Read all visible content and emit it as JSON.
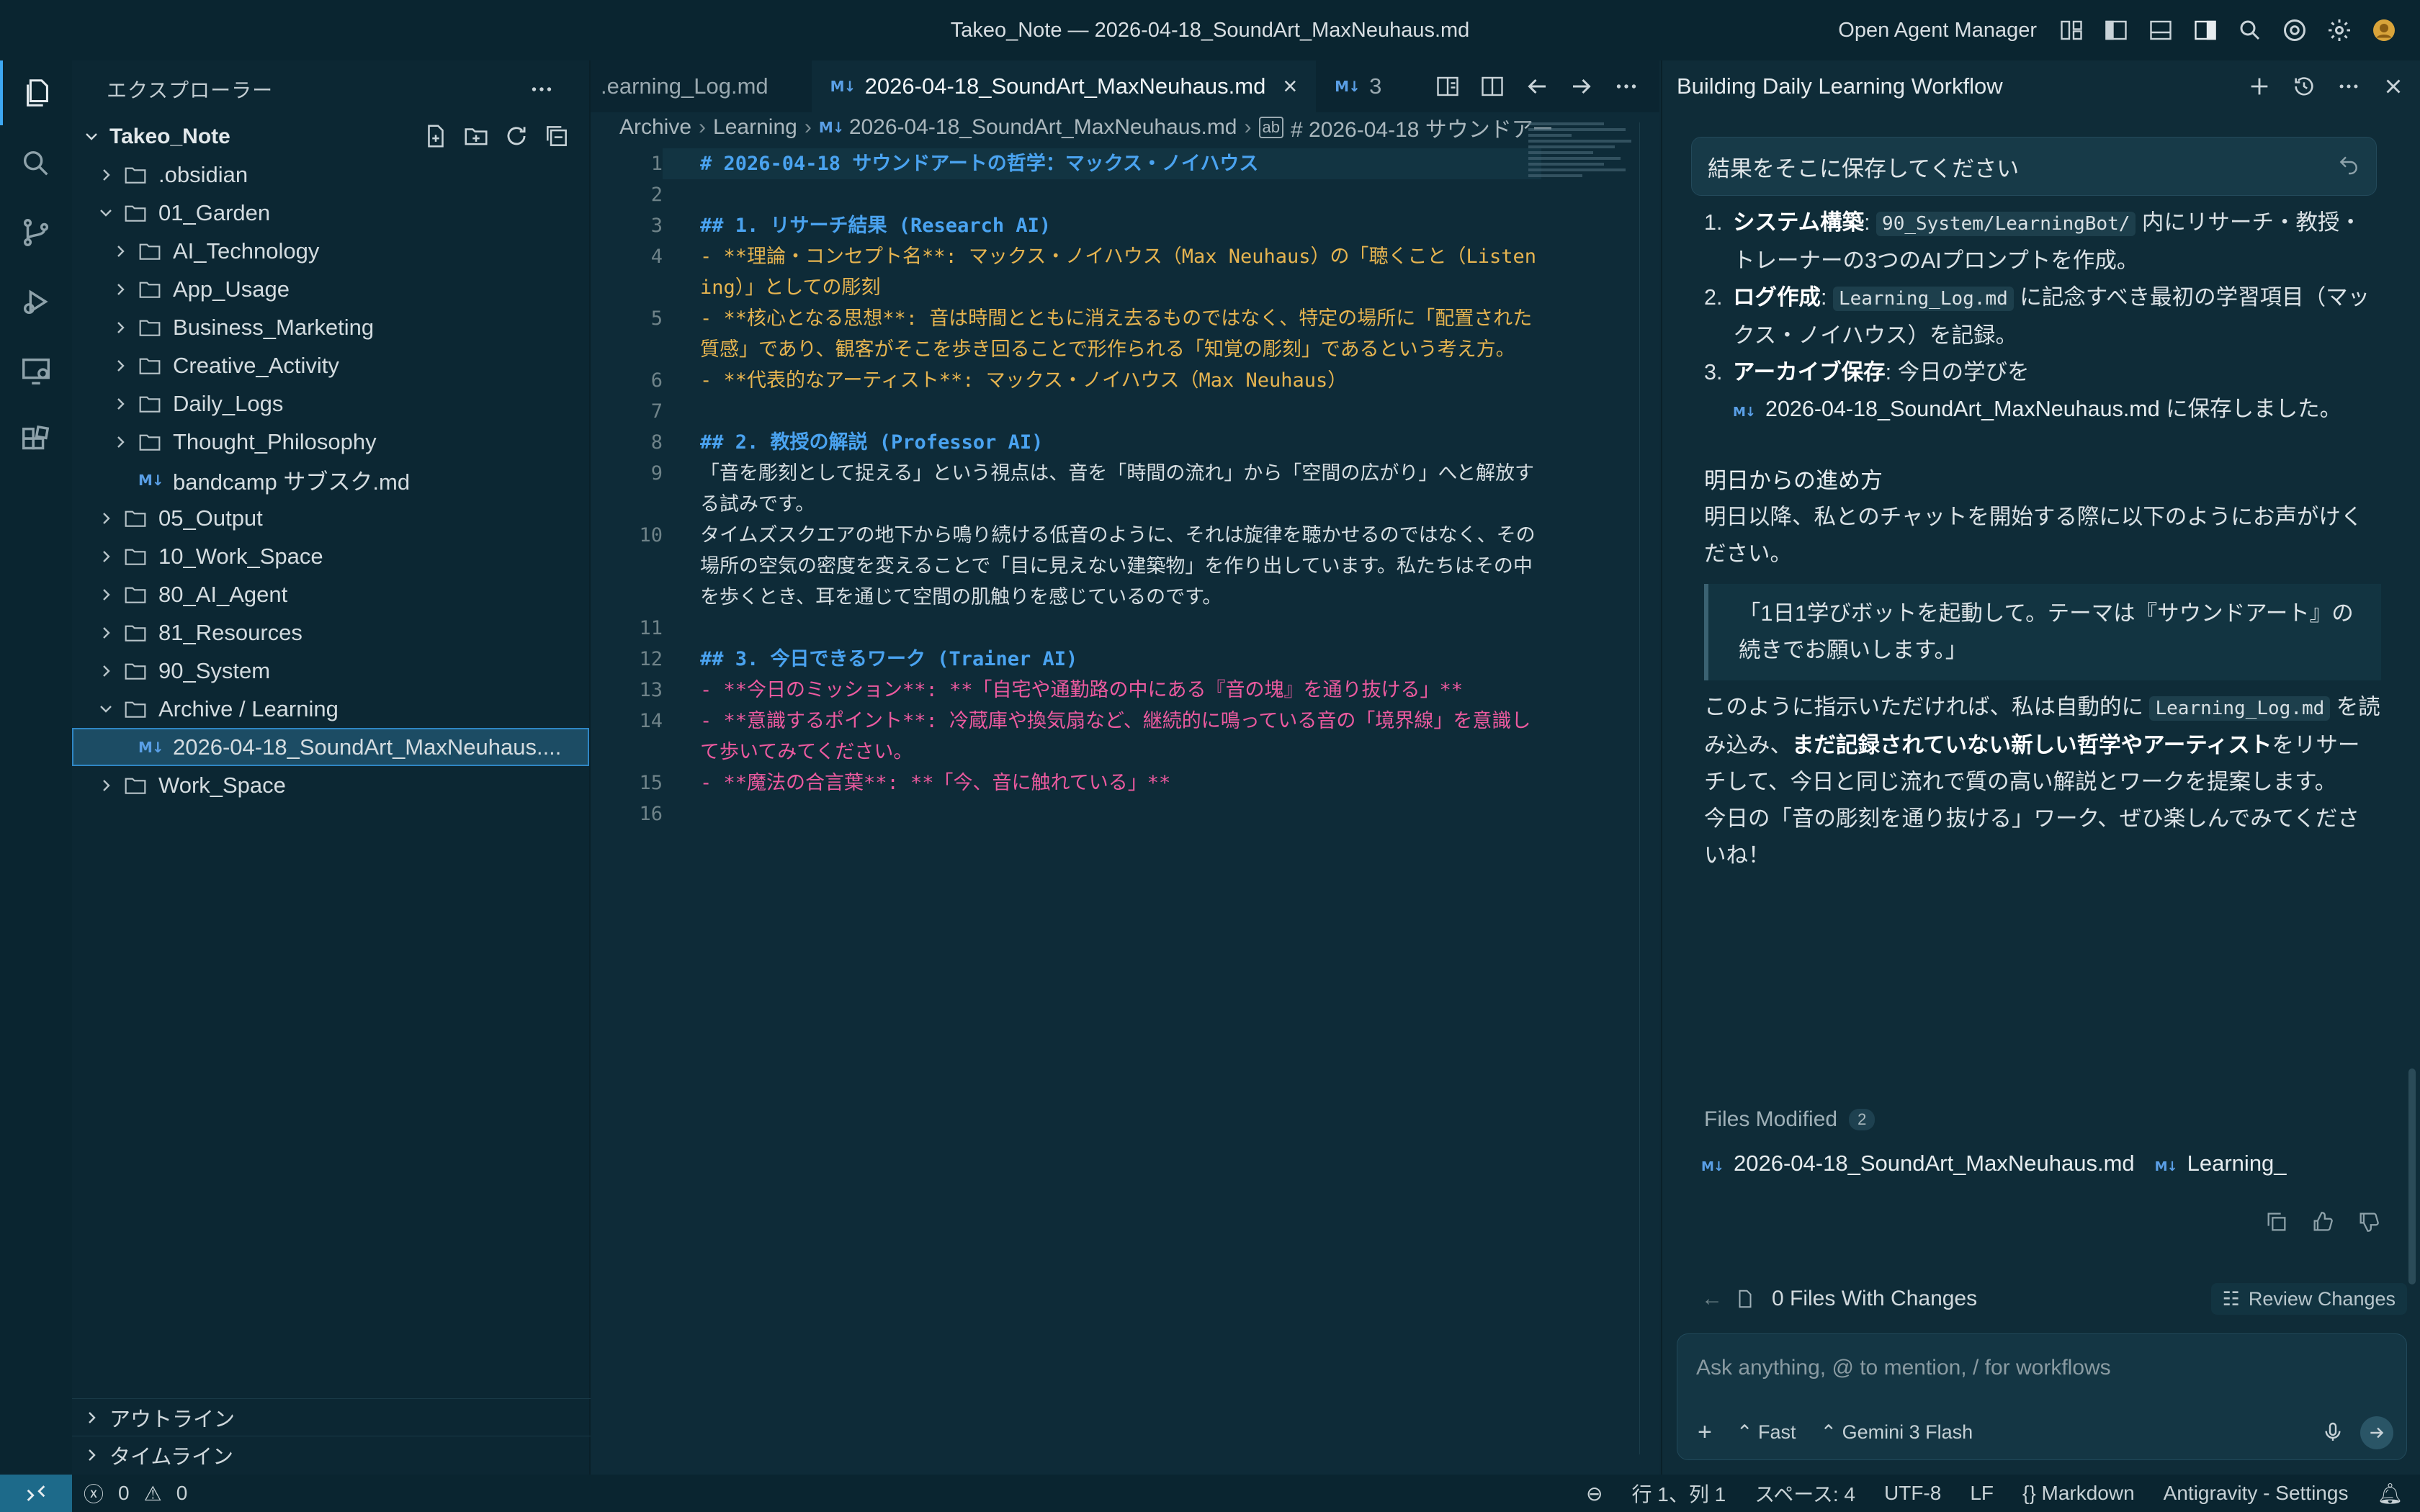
{
  "window": {
    "title": "Takeo_Note — 2026-04-18_SoundArt_MaxNeuhaus.md",
    "agent_manager": "Open Agent Manager"
  },
  "sidebar": {
    "title": "エクスプローラー",
    "root": "Takeo_Note",
    "items": [
      {
        "label": ".obsidian",
        "type": "folder"
      },
      {
        "label": "01_Garden",
        "type": "folder-open"
      },
      {
        "label": "AI_Technology",
        "type": "folder"
      },
      {
        "label": "App_Usage",
        "type": "folder"
      },
      {
        "label": "Business_Marketing",
        "type": "folder"
      },
      {
        "label": "Creative_Activity",
        "type": "folder"
      },
      {
        "label": "Daily_Logs",
        "type": "folder"
      },
      {
        "label": "Thought_Philosophy",
        "type": "folder"
      },
      {
        "label": "bandcamp サブスク.md",
        "type": "file"
      },
      {
        "label": "05_Output",
        "type": "folder"
      },
      {
        "label": "10_Work_Space",
        "type": "folder"
      },
      {
        "label": "80_AI_Agent",
        "type": "folder"
      },
      {
        "label": "81_Resources",
        "type": "folder"
      },
      {
        "label": "90_System",
        "type": "folder"
      },
      {
        "label": "Archive / Learning",
        "type": "folder-open"
      },
      {
        "label": "2026-04-18_SoundArt_MaxNeuhaus....",
        "type": "file"
      },
      {
        "label": "Work_Space",
        "type": "folder"
      }
    ],
    "outline": "アウトライン",
    "timeline": "タイムライン"
  },
  "editor": {
    "tabs": [
      {
        "label": ".earning_Log.md"
      },
      {
        "label": "2026-04-18_SoundArt_MaxNeuhaus.md"
      },
      {
        "label": "3"
      }
    ],
    "breadcrumb": [
      "Archive",
      "Learning",
      "2026-04-18_SoundArt_MaxNeuhaus.md",
      "# 2026-04-18 サウンドアー"
    ],
    "lines": [
      {
        "n": "1",
        "text": "# 2026-04-18 サウンドアートの哲学：マックス・ノイハウス"
      },
      {
        "n": "2",
        "text": ""
      },
      {
        "n": "3",
        "text": "## 1. リサーチ結果 (Research AI)"
      },
      {
        "n": "4",
        "text": "- **理論・コンセプト名**: マックス・ノイハウス（Max Neuhaus）の「聴くこと（Listening）」としての彫刻"
      },
      {
        "n": "5",
        "text": "- **核心となる思想**: 音は時間とともに消え去るものではなく、特定の場所に「配置された質感」であり、観客がそこを歩き回ることで形作られる「知覚の彫刻」であるという考え方。"
      },
      {
        "n": "6",
        "text": "- **代表的なアーティスト**: マックス・ノイハウス（Max Neuhaus）"
      },
      {
        "n": "7",
        "text": ""
      },
      {
        "n": "8",
        "text": "## 2. 教授の解説 (Professor AI)"
      },
      {
        "n": "9",
        "text": "「音を彫刻として捉える」という視点は、音を「時間の流れ」から「空間の広がり」へと解放する試みです。"
      },
      {
        "n": "10",
        "text": "タイムズスクエアの地下から鳴り続ける低音のように、それは旋律を聴かせるのではなく、その場所の空気の密度を変えることで「目に見えない建築物」を作り出しています。私たちはその中を歩くとき、耳を通じて空間の肌触りを感じているのです。"
      },
      {
        "n": "11",
        "text": ""
      },
      {
        "n": "12",
        "text": "## 3. 今日できるワーク (Trainer AI)"
      },
      {
        "n": "13",
        "text": "- **今日のミッション**: **「自宅や通勤路の中にある『音の塊』を通り抜ける」**"
      },
      {
        "n": "14",
        "text": "- **意識するポイント**: 冷蔵庫や換気扇など、継続的に鳴っている音の「境界線」を意識して歩いてみてください。"
      },
      {
        "n": "15",
        "text": "- **魔法の合言葉**: **「今、音に触れている」**"
      },
      {
        "n": "16",
        "text": ""
      }
    ]
  },
  "panel": {
    "title": "Building Daily Learning Workflow",
    "user_message": "結果をそこに保存してください",
    "steps": [
      {
        "num": "1.",
        "bold": "システム構築",
        "code": "90_System/LearningBot/",
        "rest": " 内にリサーチ・教授・トレーナーの3つのAIプロンプトを作成。"
      },
      {
        "num": "2.",
        "bold": "ログ作成",
        "code": "Learning_Log.md",
        "rest": " に記念すべき最初の学習項目（マックス・ノイハウス）を記録。"
      },
      {
        "num": "3.",
        "bold": "アーカイブ保存",
        "pre": ": 今日の学びを",
        "file": "2026-04-18_SoundArt_MaxNeuhaus.md",
        "rest": " に保存しました。"
      }
    ],
    "next_title": "明日からの進め方",
    "next_text": "明日以降、私とのチャットを開始する際に以下のようにお声がけください。",
    "quote": "「1日1学びボットを起動して。テーマは『サウンドアート』の続きでお願いします。」",
    "after_pre": "このように指示いただければ、私は自動的に",
    "after_code": "Learning_Log.md",
    "after_mid": "を読み込み、",
    "after_bold": "まだ記録されていない新しい哲学やアーティスト",
    "after_post": "をリサーチして、今日と同じ流れで質の高い解説とワークを提案します。",
    "closing": "今日の「音の彫刻を通り抜ける」ワーク、ぜひ楽しんでみてくださいね！",
    "files_modified_label": "Files Modified",
    "files_modified_count": "2",
    "files": [
      "2026-04-18_SoundArt_MaxNeuhaus.md",
      "Learning_"
    ],
    "changes_label": "0 Files With Changes",
    "review_label": "Review Changes",
    "input_placeholder": "Ask anything, @ to mention, / for workflows",
    "mode": "Fast",
    "model": "Gemini 3 Flash"
  },
  "status": {
    "errors": "0",
    "warnings": "0",
    "position": "行 1、列 1",
    "spaces": "スペース: 4",
    "encoding": "UTF-8",
    "eol": "LF",
    "language": "Markdown",
    "settings": "Antigravity - Settings"
  }
}
